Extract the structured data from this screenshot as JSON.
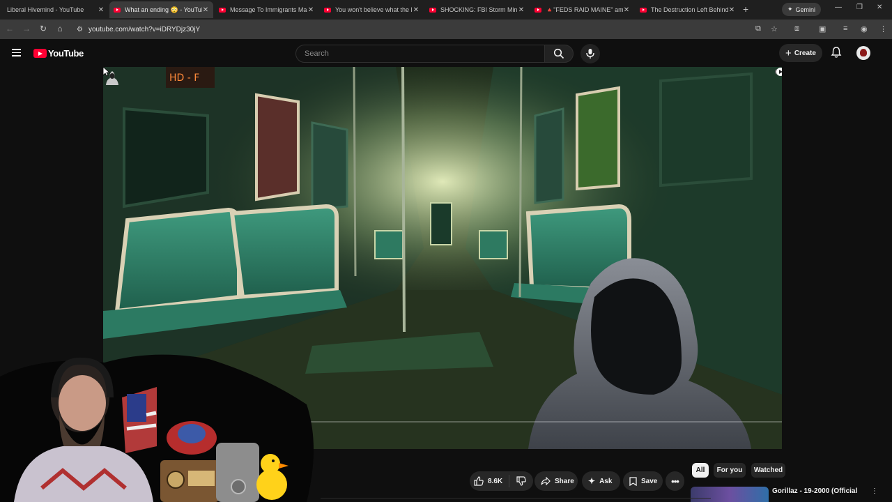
{
  "browser": {
    "tabs": [
      {
        "title": "Liberal Hivemind - YouTube",
        "active": false
      },
      {
        "title": "What an ending 😳 - YouTube",
        "active": true
      },
      {
        "title": "Message To Immigrants Mak",
        "active": false
      },
      {
        "title": "You won't believe what the le",
        "active": false
      },
      {
        "title": "SHOCKING: FBI Storm Minne",
        "active": false
      },
      {
        "title": "🔺\"FEDS RAID MAINE\" amid",
        "active": false
      },
      {
        "title": "The Destruction Left Behind",
        "active": false
      }
    ],
    "new_tab": "+",
    "gemini_label": "Gemini",
    "url": "youtube.com/watch?v=iDRYDjz30jY",
    "accent": "#ff0033"
  },
  "youtube": {
    "logo_text": "YouTube",
    "search_placeholder": "Search",
    "create_label": "Create"
  },
  "player": {
    "progress": 0.0,
    "cursor_icon": "arrow-cursor-icon"
  },
  "actions": {
    "likes": "8.6K",
    "share": "Share",
    "ask": "Ask",
    "save": "Save"
  },
  "filters": {
    "chips": [
      "All",
      "For you",
      "Watched"
    ],
    "selected": "All"
  },
  "recommended": {
    "title": "Gorillaz - 19-2000 (Official"
  }
}
